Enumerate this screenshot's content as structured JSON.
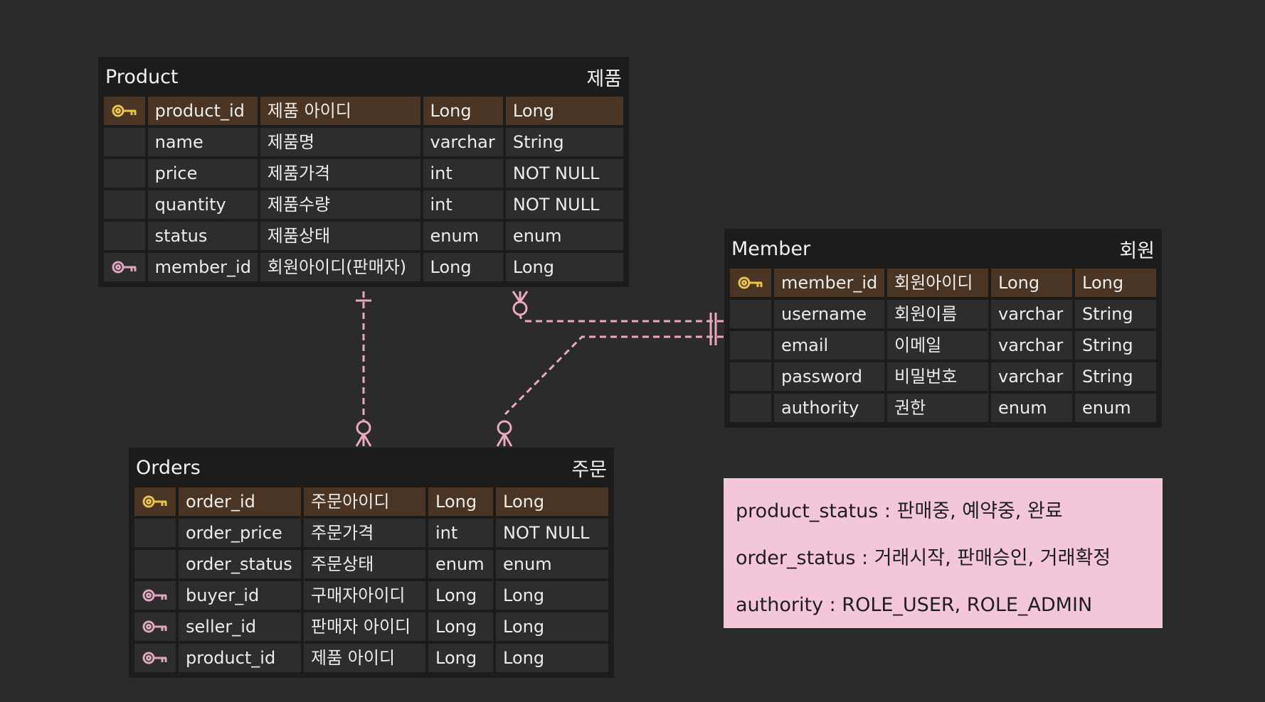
{
  "colors": {
    "background": "#2b2b2b",
    "table_bg": "#1c1c1c",
    "cell_bg": "#2d2d2d",
    "pk_row_bg": "#4a3524",
    "pk_key": "#e8c547",
    "fk_key": "#e0a6bf",
    "relation_line": "#e8a9c1",
    "note_bg": "#f4c6d9"
  },
  "entities": {
    "product": {
      "name": "Product",
      "label": "제품",
      "rows": [
        {
          "key": "pk-key-icon",
          "column": "product_id",
          "comment": "제품 아이디",
          "db_type": "Long",
          "java_type": "Long"
        },
        {
          "key": "",
          "column": "name",
          "comment": "제품명",
          "db_type": "varchar",
          "java_type": "String"
        },
        {
          "key": "",
          "column": "price",
          "comment": "제품가격",
          "db_type": "int",
          "java_type": "NOT NULL"
        },
        {
          "key": "",
          "column": "quantity",
          "comment": "제품수량",
          "db_type": "int",
          "java_type": "NOT NULL"
        },
        {
          "key": "",
          "column": "status",
          "comment": "제품상태",
          "db_type": "enum",
          "java_type": "enum"
        },
        {
          "key": "fk-key-icon",
          "column": "member_id",
          "comment": "회원아이디(판매자)",
          "db_type": "Long",
          "java_type": "Long"
        }
      ]
    },
    "member": {
      "name": "Member",
      "label": "회원",
      "rows": [
        {
          "key": "pk-key-icon",
          "column": "member_id",
          "comment": "회원아이디",
          "db_type": "Long",
          "java_type": "Long"
        },
        {
          "key": "",
          "column": "username",
          "comment": "회원이름",
          "db_type": "varchar",
          "java_type": "String"
        },
        {
          "key": "",
          "column": "email",
          "comment": "이메일",
          "db_type": "varchar",
          "java_type": "String"
        },
        {
          "key": "",
          "column": "password",
          "comment": "비밀번호",
          "db_type": "varchar",
          "java_type": "String"
        },
        {
          "key": "",
          "column": "authority",
          "comment": "권한",
          "db_type": "enum",
          "java_type": "enum"
        }
      ]
    },
    "orders": {
      "name": "Orders",
      "label": "주문",
      "rows": [
        {
          "key": "pk-key-icon",
          "column": "order_id",
          "comment": "주문아이디",
          "db_type": "Long",
          "java_type": "Long"
        },
        {
          "key": "",
          "column": "order_price",
          "comment": "주문가격",
          "db_type": "int",
          "java_type": "NOT NULL"
        },
        {
          "key": "",
          "column": "order_status",
          "comment": "주문상태",
          "db_type": "enum",
          "java_type": "enum"
        },
        {
          "key": "fk-key-icon",
          "column": "buyer_id",
          "comment": "구매자아이디",
          "db_type": "Long",
          "java_type": "Long"
        },
        {
          "key": "fk-key-icon",
          "column": "seller_id",
          "comment": "판매자 아이디",
          "db_type": "Long",
          "java_type": "Long"
        },
        {
          "key": "fk-key-icon",
          "column": "product_id",
          "comment": "제품 아이디",
          "db_type": "Long",
          "java_type": "Long"
        }
      ]
    }
  },
  "relationships": [
    {
      "from": "Product",
      "from_end": "one-mandatory",
      "to": "Orders",
      "to_end": "zero-or-many"
    },
    {
      "from": "Member",
      "from_end": "one-mandatory",
      "to": "Product",
      "to_end": "zero-or-many"
    },
    {
      "from": "Member",
      "from_end": "one-mandatory",
      "to": "Orders",
      "to_end": "zero-or-many"
    }
  ],
  "note": {
    "lines": [
      "product_status : 판매중, 예약중, 완료",
      "order_status : 거래시작, 판매승인, 거래확정",
      "authority : ROLE_USER, ROLE_ADMIN"
    ]
  }
}
